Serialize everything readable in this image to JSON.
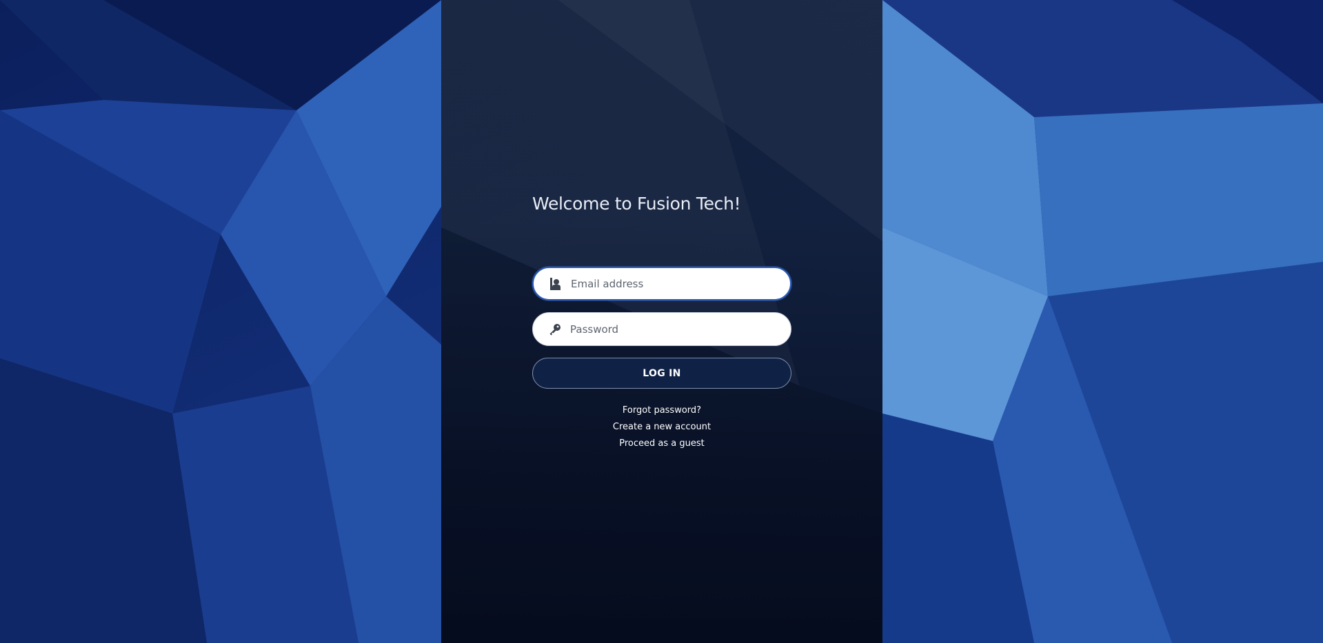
{
  "page": {
    "title": "Welcome to Fusion Tech!"
  },
  "form": {
    "email": {
      "placeholder": "Email address",
      "value": "",
      "icon": "user-icon"
    },
    "password": {
      "placeholder": "Password",
      "value": "",
      "icon": "key-icon"
    },
    "login_label": "LOG IN"
  },
  "links": {
    "forgot_password": "Forgot password?",
    "create_account": "Create a new account",
    "guest": "Proceed as a guest"
  },
  "colors": {
    "background_blue": "#0e2a6e",
    "panel_dark": "#121e32",
    "button_bg": "#0f2246",
    "focus_border": "#2a5bb8",
    "text_light": "#ffffff"
  }
}
